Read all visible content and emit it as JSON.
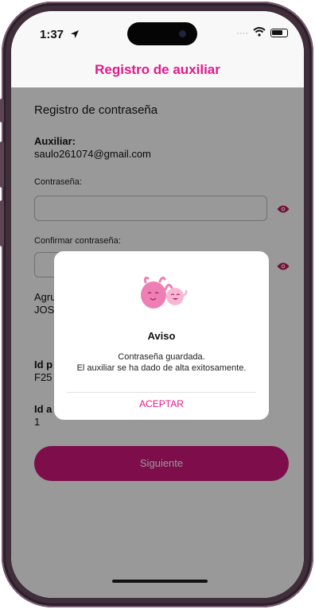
{
  "status_bar": {
    "time": "1:37"
  },
  "nav": {
    "title": "Registro de auxiliar"
  },
  "form": {
    "section_title": "Registro de contraseña",
    "auxiliar_label": "Auxiliar:",
    "auxiliar_email": "saulo261074@gmail.com",
    "password_label": "Contraseña:",
    "password_value": "",
    "confirm_label": "Confirmar contraseña:",
    "confirm_value": "",
    "group_label": "Agru",
    "group_value": "JOS",
    "id_label_1": "Id p",
    "id_value_1": "F25",
    "id_label_2": "Id a",
    "id_value_2": "1",
    "next_button": "Siguiente"
  },
  "dialog": {
    "title": "Aviso",
    "message_line1": "Contraseña guardada.",
    "message_line2": "El auxiliar se ha dado de alta exitosamente.",
    "accept_button": "ACEPTAR"
  },
  "colors": {
    "accent": "#e2198a",
    "button": "#d1187d",
    "eye_icon": "#c2185b"
  },
  "icons": [
    "location-arrow-icon",
    "wifi-icon",
    "battery-icon",
    "eye-icon",
    "mascot-illustration"
  ]
}
